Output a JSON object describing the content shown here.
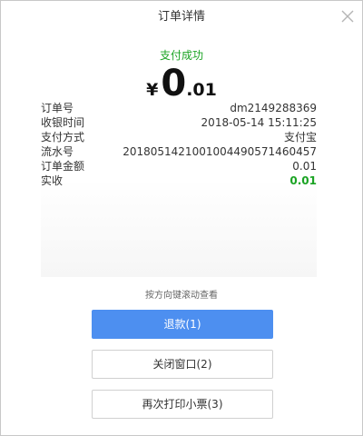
{
  "dialog": {
    "title": "订单详情"
  },
  "payment": {
    "status": "支付成功",
    "currency_symbol": "¥",
    "amount_integer": "0",
    "amount_decimal": ".01"
  },
  "details": [
    {
      "label": "订单号",
      "value": "dm2149288369"
    },
    {
      "label": "收银时间",
      "value": "2018-05-14 15:11:25"
    },
    {
      "label": "支付方式",
      "value": "支付宝"
    },
    {
      "label": "流水号",
      "value": "2018051421001004490571460457"
    },
    {
      "label": "订单金额",
      "value": "0.01"
    },
    {
      "label": "实收",
      "value": "0.01"
    }
  ],
  "scroll_hint": "按方向键滚动查看",
  "buttons": {
    "refund": "退款(1)",
    "close_window": "关闭窗口(2)",
    "reprint": "再次打印小票(3)"
  },
  "colors": {
    "accent": "#4d8ff0",
    "success": "#1aa323"
  }
}
